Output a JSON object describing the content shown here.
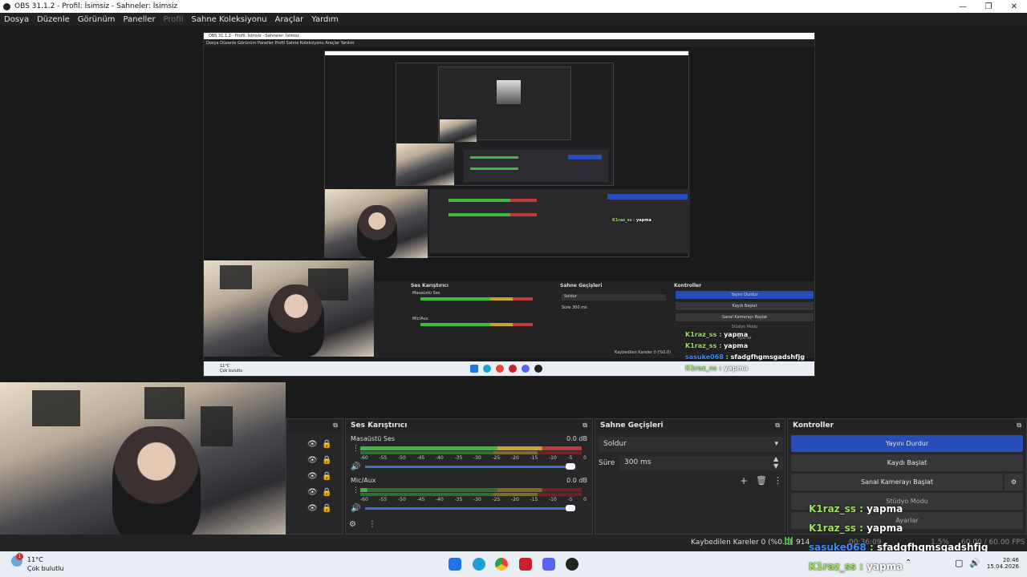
{
  "window": {
    "title": "OBS 31.1.2 - Profil: İsimsiz - Sahneler: İsimsiz"
  },
  "menu": {
    "items": [
      "Dosya",
      "Düzenle",
      "Görünüm",
      "Paneller",
      "Profil",
      "Sahne Koleksiyonu",
      "Araçlar",
      "Yardım"
    ]
  },
  "preview": {
    "nested_title": "OBS 31.1.2 - Profil: İsimsiz - Sahneler: İsimsiz",
    "nested_menu": "Dosya  Düzenle  Görünüm  Paneller  Profil  Sahne Koleksiyonu  Araçlar  Yardım",
    "nested_mixer": "Ses Karıştırıcı",
    "nested_transitions": "Sahne Geçişleri",
    "nested_controls": "Kontroller",
    "nested_btn1": "Yayını Durdur",
    "nested_btn2": "Kaydı Başlat",
    "nested_btn3": "Sanal Kamerayı Başlat",
    "nested_btn4": "Stüdyo Modu",
    "nested_btn5": "Ayarlar",
    "nested_fade": "Soldur",
    "nested_dur_label": "Süre",
    "nested_dur": "300 ms",
    "nested_ch1": "Masaüstü Ses",
    "nested_ch2": "Mic/Aux",
    "nested_dropped": "Kaybedilen Kareler 0 (%0.0)",
    "nested_weather": "Çok bulutlu",
    "nested_temp": "11°C"
  },
  "mixer": {
    "title": "Ses Karıştırıcı",
    "channels": [
      {
        "name": "Masaüstü Ses",
        "db": "0.0 dB",
        "level": 0.97
      },
      {
        "name": "Mic/Aux",
        "db": "0.0 dB",
        "level": 0.97
      }
    ],
    "ticks": [
      "-60",
      "-55",
      "-50",
      "-45",
      "-40",
      "-35",
      "-30",
      "-25",
      "-20",
      "-15",
      "-10",
      "-5",
      "0"
    ]
  },
  "transitions": {
    "title": "Sahne Geçişleri",
    "selected": "Soldur",
    "duration_label": "Süre",
    "duration": "300 ms"
  },
  "controls": {
    "title": "Kontroller",
    "stream": "Yayını Durdur",
    "record": "Kaydı Başlat",
    "virtualcam": "Sanal Kamerayı Başlat",
    "studio": "Stüdyo Modu",
    "settings": "Ayarlar"
  },
  "chat": [
    {
      "name": "K1raz_ss",
      "msg": "yapma"
    },
    {
      "name": "K1raz_ss",
      "msg": "yapma"
    },
    {
      "name": "sasuke068",
      "msg": "sfadgfhgmsgadshfjg"
    },
    {
      "name": "K1raz_ss",
      "msg": "yapma"
    }
  ],
  "nested_chat": [
    {
      "name": "K1raz_ss",
      "msg": "yapma"
    },
    {
      "name": "K1raz_ss",
      "msg": "yapma"
    },
    {
      "name": "sasuke068",
      "msg": "sfadgfhgmsgadshfjg"
    },
    {
      "name": "K1raz_ss",
      "msg": "yapma"
    }
  ],
  "status": {
    "dropped": "Kaybedilen Kareler 0 (%0.0)",
    "bitrate": "914",
    "fps_1": "60.00 / 60.00 FPS",
    "cpu": "1.5%",
    "time": "00:36:09"
  },
  "taskbar": {
    "temp": "11°C",
    "weather": "Çok bulutlu",
    "clock": "20:46",
    "date": "15.04.2026",
    "notification_count": "1"
  },
  "colors": {
    "accent": "#284cb8",
    "chat_name": "#9be35a",
    "meter_green": "#3fb83f",
    "meter_yellow": "#c9a32b",
    "meter_red": "#bd3b3b"
  }
}
